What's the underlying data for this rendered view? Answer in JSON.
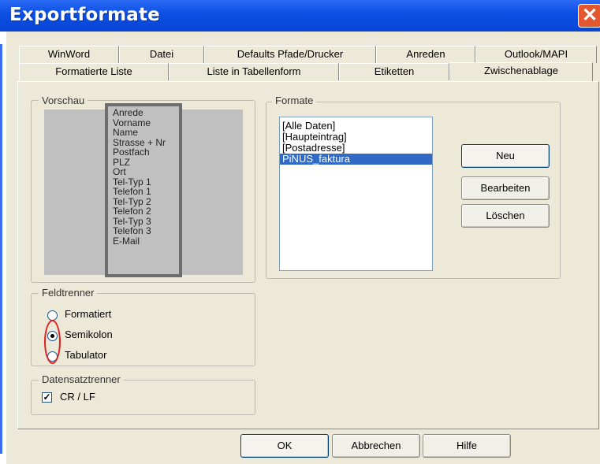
{
  "window": {
    "title": "Exportformate",
    "close_glyph": "✕"
  },
  "tabs_row1": [
    "WinWord",
    "Datei",
    "Defaults Pfade/Drucker",
    "Anreden",
    "Outlook/MAPI"
  ],
  "tabs_row2": [
    "Formatierte Liste",
    "Liste in Tabellenform",
    "Etiketten",
    "Zwischenablage"
  ],
  "active_tab": "Zwischenablage",
  "preview": {
    "label": "Vorschau",
    "fields": [
      "Anrede",
      "Vorname",
      "Name",
      "Strasse + Nr",
      "Postfach",
      "PLZ",
      "Ort",
      "Tel-Typ 1",
      "Telefon 1",
      "Tel-Typ 2",
      "Telefon 2",
      "Tel-Typ 3",
      "Telefon 3",
      "E-Mail"
    ]
  },
  "formate": {
    "label": "Formate",
    "items": [
      "[Alle Daten]",
      "[Haupteintrag]",
      "[Postadresse]",
      "PiNUS_faktura"
    ],
    "selected_index": 3,
    "buttons": {
      "neu": "Neu",
      "bearbeiten": "Bearbeiten",
      "loeschen": "Löschen"
    }
  },
  "feldtrenner": {
    "label": "Feldtrenner",
    "options": [
      "Formatiert",
      "Semikolon",
      "Tabulator"
    ],
    "selected": "Semikolon"
  },
  "datensatztrenner": {
    "label": "Datensatztrenner",
    "checkbox_label": "CR / LF",
    "checked": true,
    "check_glyph": "✓"
  },
  "footer": {
    "ok": "OK",
    "abbrechen": "Abbrechen",
    "hilfe": "Hilfe"
  },
  "colors": {
    "titlebar": "#0a4fe3",
    "selection": "#316ac5",
    "annotation": "#e11e1e",
    "close": "#e2572f"
  }
}
